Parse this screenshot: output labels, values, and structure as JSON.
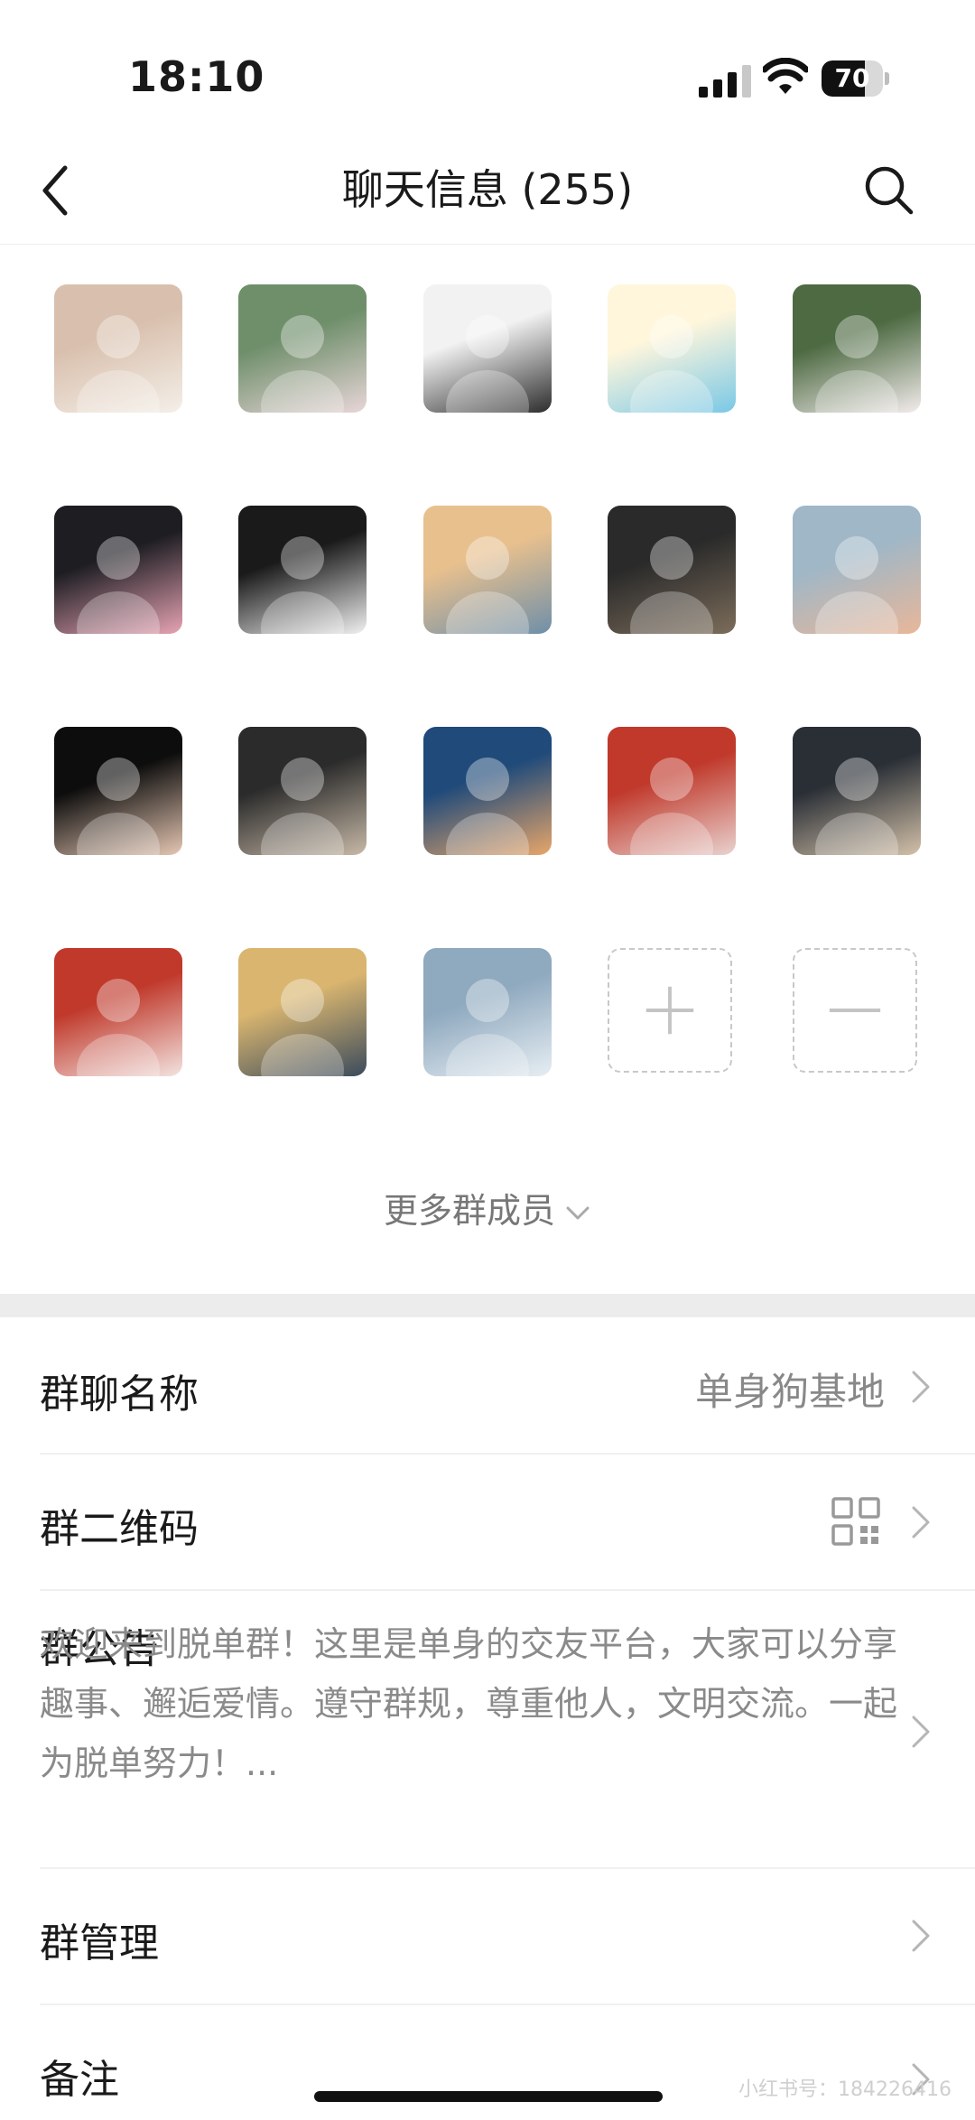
{
  "status_bar": {
    "time": "18:10",
    "battery": "70",
    "battery_level": 0.7
  },
  "nav": {
    "title": "聊天信息 (255)"
  },
  "members": [
    {
      "name": "",
      "colors": [
        "#d9c0ae",
        "#f4efe8"
      ]
    },
    {
      "name": "",
      "colors": [
        "#6f8f6b",
        "#e8d6d8"
      ]
    },
    {
      "name": "",
      "colors": [
        "#f2f2f2",
        "#2d2d2d"
      ]
    },
    {
      "name": "",
      "colors": [
        "#fff6dc",
        "#79c8e6"
      ]
    },
    {
      "name": "",
      "colors": [
        "#4d6a42",
        "#f3ecec"
      ]
    },
    {
      "name": "",
      "colors": [
        "#1d1d22",
        "#e7a3b4"
      ]
    },
    {
      "name": "",
      "colors": [
        "#1a1a1a",
        "#f1f1f1"
      ]
    },
    {
      "name": "",
      "colors": [
        "#e8c08e",
        "#6f8fa8"
      ]
    },
    {
      "name": "",
      "colors": [
        "#2a2a2a",
        "#7c6d5b"
      ]
    },
    {
      "name": "",
      "colors": [
        "#9fb7c7",
        "#e8b79a"
      ]
    },
    {
      "name": "",
      "colors": [
        "#0d0d0d",
        "#e6c7b3"
      ]
    },
    {
      "name": "",
      "colors": [
        "#2b2b2b",
        "#c7b9a7"
      ]
    },
    {
      "name": "",
      "colors": [
        "#1f4a7a",
        "#e8a66a"
      ]
    },
    {
      "name": "",
      "colors": [
        "#c0392b",
        "#e9d2cf"
      ]
    },
    {
      "name": "",
      "colors": [
        "#2a2f36",
        "#d3c1a9"
      ]
    },
    {
      "name": "",
      "colors": [
        "#c0392b",
        "#f3e3e0"
      ]
    },
    {
      "name": "",
      "colors": [
        "#d9b56f",
        "#3b4b5c"
      ]
    },
    {
      "name": "",
      "colors": [
        "#8fa9bf",
        "#e7eef3"
      ]
    }
  ],
  "more_members": "更多群成员",
  "settings": {
    "group_name": {
      "label": "群聊名称",
      "value": "单身狗基地"
    },
    "qr_code": {
      "label": "群二维码"
    },
    "notice": {
      "label": "群公告",
      "text": "欢迎来到脱单群！这里是单身的交友平台，大家可以分享趣事、邂逅爱情。遵守群规，尊重他人，文明交流。一起为脱单努力！..."
    },
    "manage": {
      "label": "群管理"
    },
    "remark": {
      "label": "备注"
    }
  },
  "watermark": "小红书号：184226416"
}
